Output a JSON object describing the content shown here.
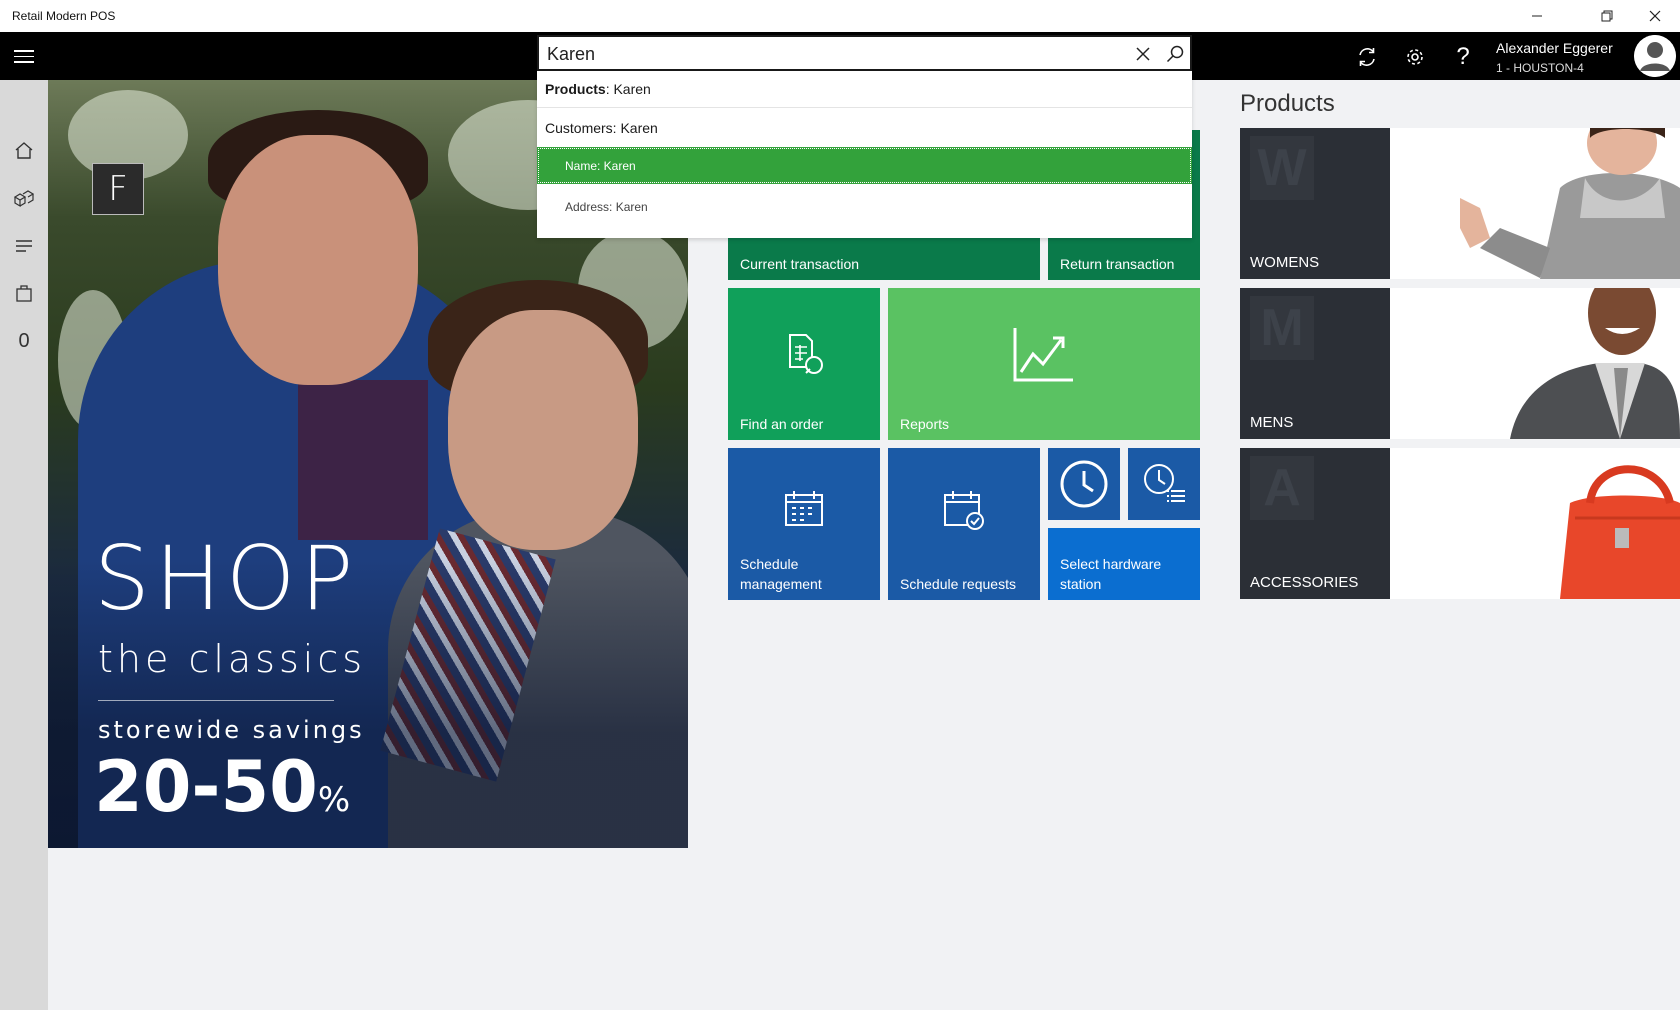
{
  "window": {
    "title": "Retail Modern POS",
    "minimize": "—",
    "restore": "❐",
    "close": "✕"
  },
  "user": {
    "name": "Alexander Eggerer",
    "store": "1 - HOUSTON-4"
  },
  "rail": {
    "cart_count": "0"
  },
  "search": {
    "value": "Karen",
    "results": {
      "products_prefix": "Products",
      "products_value": ": Karen",
      "customers": "Customers: Karen",
      "name": "Name: Karen",
      "address": "Address: Karen"
    }
  },
  "promo": {
    "badge": "F",
    "line1": "SHOP",
    "line2": "the classics",
    "line3": "storewide savings",
    "line4": "20-50",
    "line4_suffix": "%"
  },
  "tiles": {
    "current_transaction": "Current transaction",
    "return_transaction": "Return transaction",
    "find_order": "Find an order",
    "reports": "Reports",
    "schedule_management": "Schedule management",
    "schedule_requests": "Schedule requests",
    "select_hardware_station": "Select hardware station"
  },
  "products": {
    "title": "Products",
    "categories": [
      {
        "letter": "W",
        "label": "WOMENS"
      },
      {
        "letter": "M",
        "label": "MENS"
      },
      {
        "letter": "A",
        "label": "ACCESSORIES"
      }
    ]
  },
  "colors": {
    "dark_green": "#0a7a4a",
    "medium_green": "#10a05a",
    "light_green": "#5ac262",
    "blue": "#1b5aa6",
    "bright_blue": "#0b6ed0",
    "highlight_green": "#33a23b"
  }
}
